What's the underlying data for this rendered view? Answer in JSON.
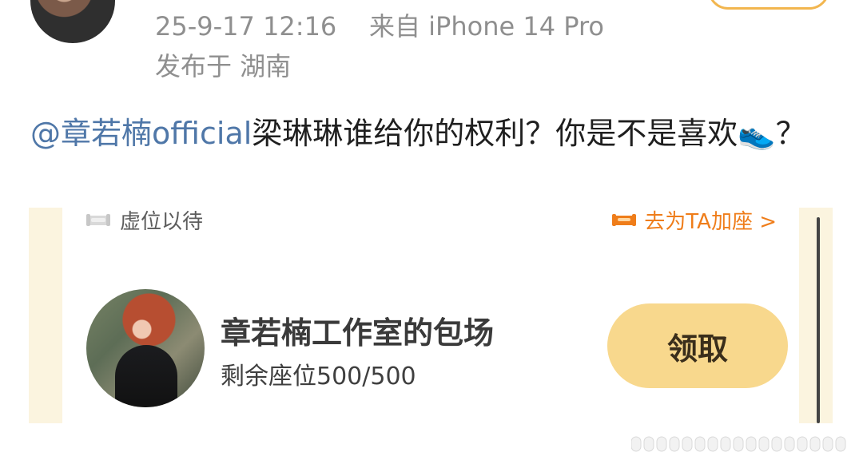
{
  "header": {
    "timestamp": "25-9-17 12:16",
    "source": "来自 iPhone 14 Pro",
    "location": "发布于 湖南"
  },
  "post": {
    "mention": "@章若楠official",
    "text": "梁琳琳谁给你的权利？你是不是喜欢",
    "emoji": "👟",
    "ending": "？"
  },
  "card": {
    "wait_label": "虚位以待",
    "add_label": "去为TA加座 >",
    "title": "章若楠工作室的包场",
    "remaining": "剩余座位500/500",
    "claim_label": "领取"
  },
  "colors": {
    "mention": "#4f77a8",
    "orange": "#ef7d1a",
    "card_bg": "#fbf4df",
    "claim_bg": "#f8d88d"
  }
}
